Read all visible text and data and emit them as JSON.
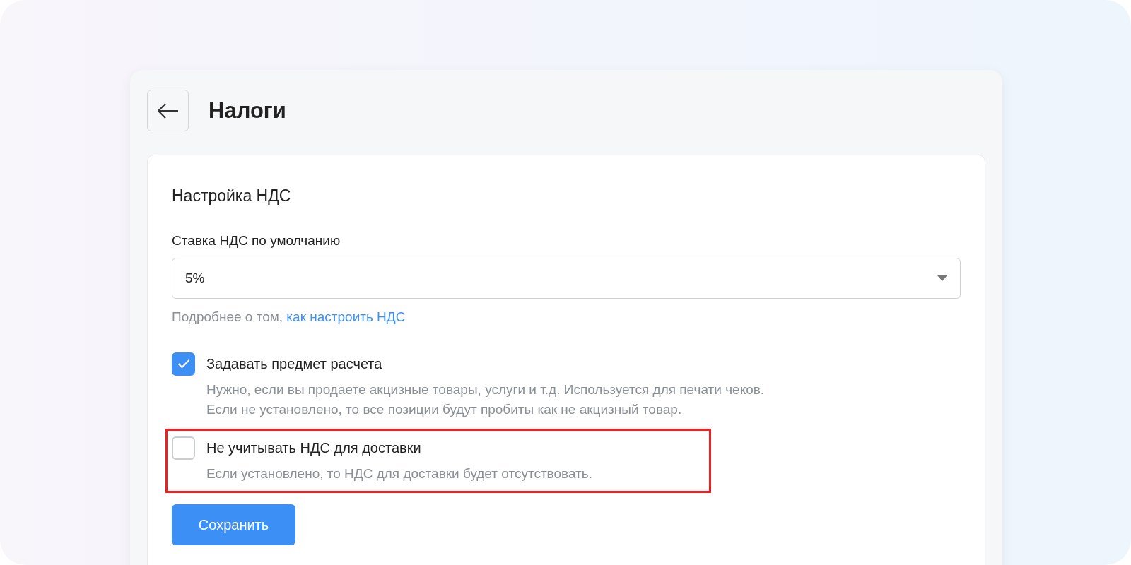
{
  "header": {
    "title": "Налоги"
  },
  "card": {
    "title": "Настройка НДС",
    "vat_rate": {
      "label": "Ставка НДС по умолчанию",
      "value": "5%"
    },
    "help": {
      "text": "Подробнее о том, ",
      "link": "как настроить НДС"
    },
    "options": [
      {
        "label": "Задавать предмет расчета",
        "description": [
          "Нужно, если вы продаете акцизные товары, услуги и т.д. Используется для печати чеков.",
          "Если не установлено, то все позиции будут пробиты как не акцизный товар."
        ],
        "checked": true,
        "highlighted": false
      },
      {
        "label": "Не учитывать НДС для доставки",
        "description": [
          "Если установлено, то НДС для доставки будет отсутствовать."
        ],
        "checked": false,
        "highlighted": true
      }
    ],
    "save_button": "Сохранить"
  }
}
